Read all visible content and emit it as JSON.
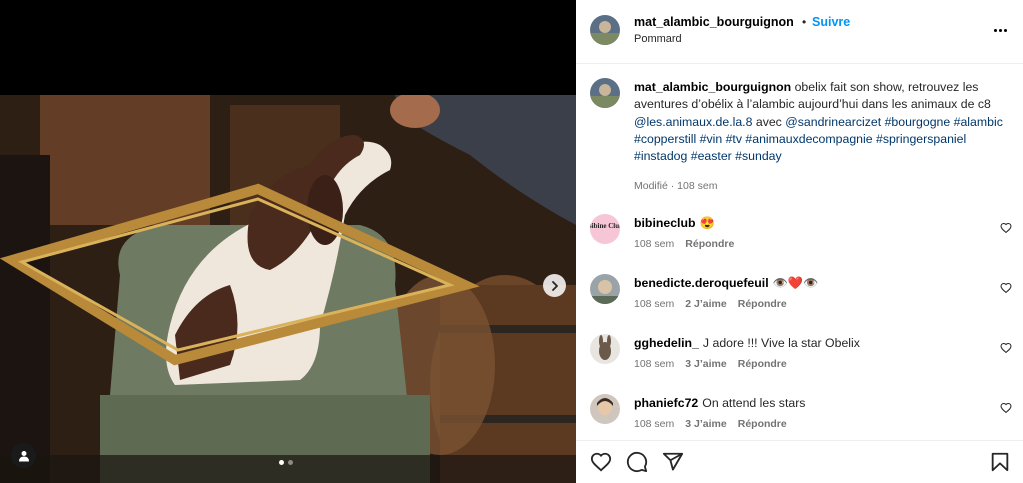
{
  "post": {
    "username": "mat_alambic_bourguignon",
    "separator": "•",
    "follow_label": "Suivre",
    "location": "Pommard",
    "caption_text": "obelix fait son show, retrouvez les aventures d’obélix à l’alambic aujourd’hui dans les animaux de c8",
    "mention_1": "@les.animaux.de.la.8",
    "with_word": "avec",
    "mention_2": "@sandrinearcizet",
    "hashtags": "#bourgogne #alambic #copperstill #vin #tv #animauxdecompagnie #springerspaniel #instadog #easter #sunday",
    "caption_meta": "Modifié · 108 sem"
  },
  "media": {
    "slide_count": 2,
    "active_slide": 1
  },
  "comments": [
    {
      "username": "bibineclub",
      "text": "😍",
      "time": "108 sem",
      "likes": "",
      "reply": "Répondre",
      "avatar_label": "Bibine Club"
    },
    {
      "username": "benedicte.deroquefeuil",
      "text": "👁️❤️👁️",
      "time": "108 sem",
      "likes": "2 J’aime",
      "reply": "Répondre"
    },
    {
      "username": "gghedelin_",
      "text": "J adore !!! Vive la star Obelix",
      "time": "108 sem",
      "likes": "3 J’aime",
      "reply": "Répondre"
    },
    {
      "username": "phaniefc72",
      "text": "On attend les stars",
      "time": "108 sem",
      "likes": "3 J’aime",
      "reply": "Répondre"
    }
  ],
  "icons": {
    "like": "heart-outline-icon",
    "comment": "comment-bubble-icon",
    "share": "paper-plane-icon",
    "save": "bookmark-icon",
    "next": "chevron-right-icon",
    "tag": "user-tag-icon",
    "more": "more-options-icon"
  },
  "colors": {
    "accent": "#0095f6",
    "link": "#00376b",
    "meta": "#737373"
  }
}
